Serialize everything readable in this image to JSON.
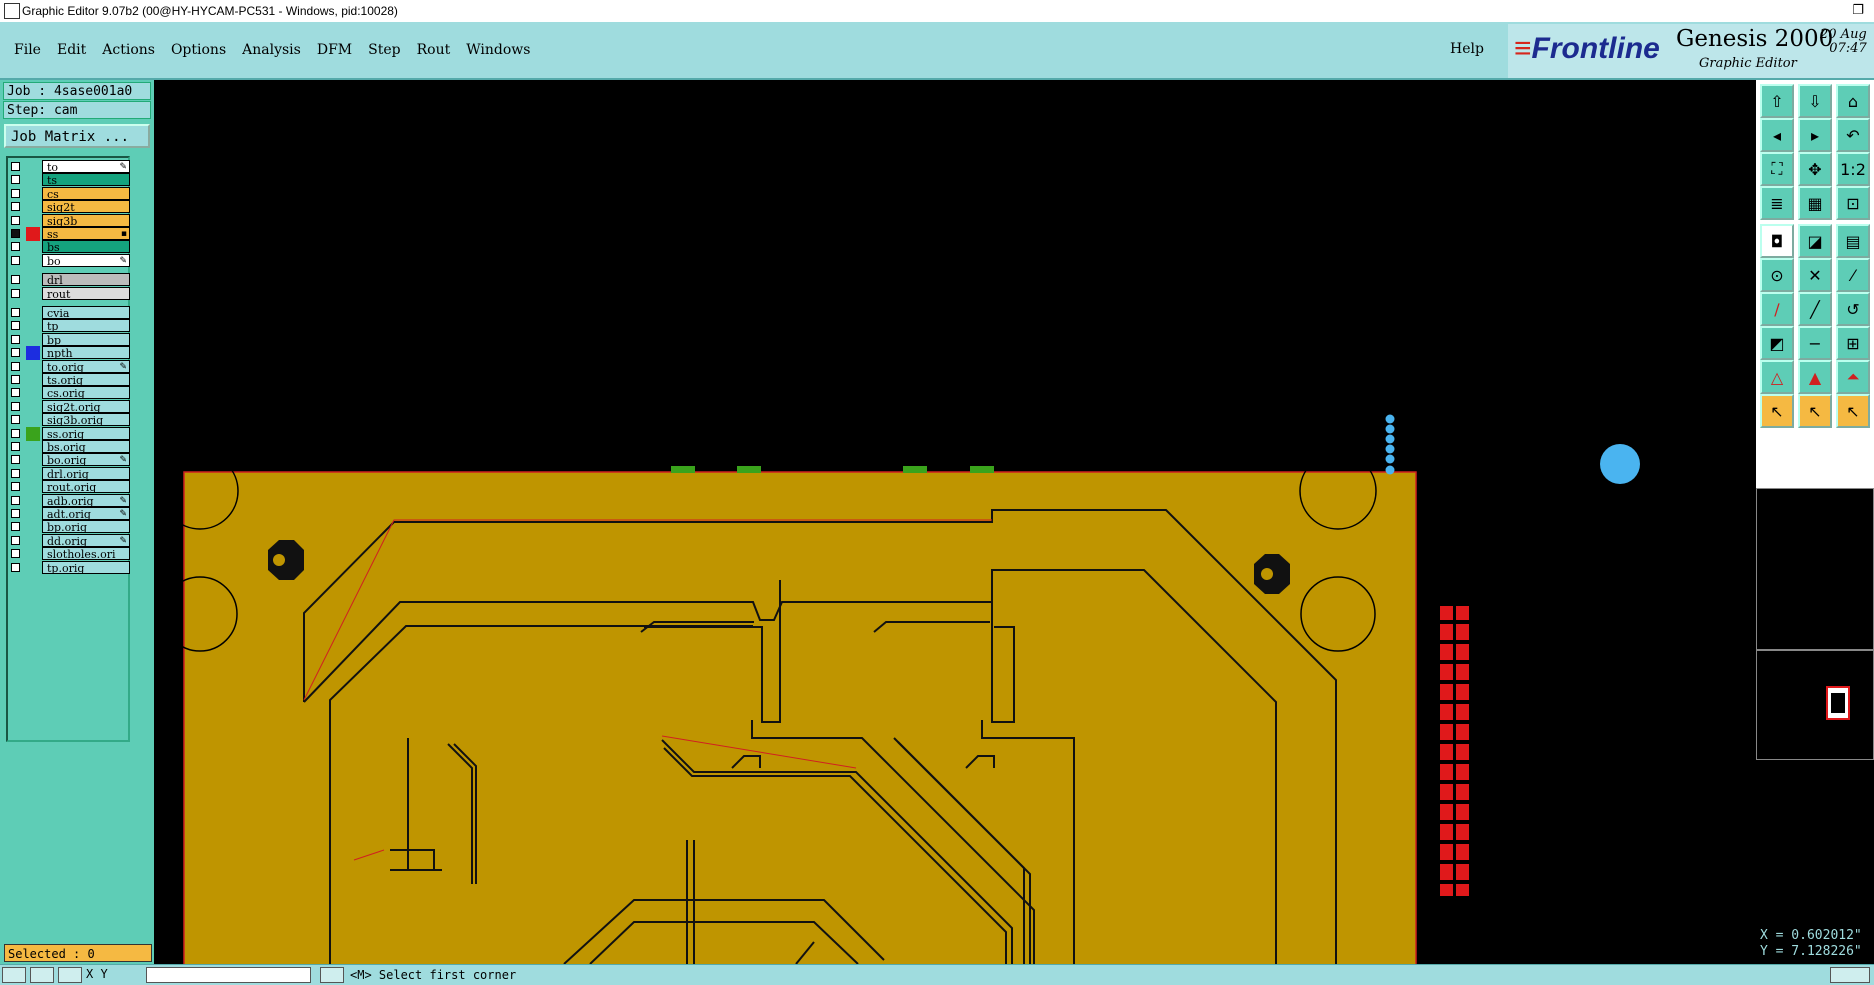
{
  "window": {
    "title": "Graphic Editor 9.07b2 (00@HY-HYCAM-PC531 - Windows, pid:10028)",
    "restore_icon": "restore-icon"
  },
  "menu": {
    "items": [
      "File",
      "Edit",
      "Actions",
      "Options",
      "Analysis",
      "DFM",
      "Step",
      "Rout",
      "Windows"
    ],
    "help": "Help"
  },
  "logo": {
    "brand": "Frontline",
    "product": "Genesis 2000",
    "subtitle": "Graphic Editor",
    "date_line1": "20 Aug",
    "date_line2": "07:47"
  },
  "job": {
    "job_line": "Job : 4sase001a0",
    "step_line": "Step: cam",
    "matrix_button": "Job Matrix ..."
  },
  "layers": [
    {
      "name": "to",
      "color": "#ffffff",
      "mark": "✎"
    },
    {
      "name": "ts",
      "color": "#14a37e"
    },
    {
      "name": "cs",
      "color": "#f5b942"
    },
    {
      "name": "sig2t",
      "color": "#f5b942"
    },
    {
      "name": "sig3b",
      "color": "#f5b942"
    },
    {
      "name": "ss",
      "color": "#f5b942",
      "checked": true,
      "swatch": "#e0191b",
      "mark": "▪"
    },
    {
      "name": "bs",
      "color": "#14a37e"
    },
    {
      "name": "bo",
      "color": "#ffffff",
      "mark": "✎"
    },
    {
      "name": "drl",
      "color": "#bcbcbc"
    },
    {
      "name": "rout",
      "color": "#dddddd"
    },
    {
      "name": "cvia",
      "color": "#9fdcde"
    },
    {
      "name": "tp",
      "color": "#9fdcde"
    },
    {
      "name": "bp",
      "color": "#9fdcde"
    },
    {
      "name": "npth",
      "color": "#9fdcde",
      "swatch": "#1c2de0"
    },
    {
      "name": "to.orig",
      "color": "#9fdcde",
      "mark": "✎"
    },
    {
      "name": "ts.orig",
      "color": "#9fdcde"
    },
    {
      "name": "cs.orig",
      "color": "#9fdcde"
    },
    {
      "name": "sig2t.orig",
      "color": "#9fdcde"
    },
    {
      "name": "sig3b.orig",
      "color": "#9fdcde"
    },
    {
      "name": "ss.orig",
      "color": "#9fdcde",
      "swatch": "#3aa31c"
    },
    {
      "name": "bs.orig",
      "color": "#9fdcde"
    },
    {
      "name": "bo.orig",
      "color": "#9fdcde",
      "mark": "✎"
    },
    {
      "name": "drl.orig",
      "color": "#9fdcde"
    },
    {
      "name": "rout.orig",
      "color": "#9fdcde"
    },
    {
      "name": "adb.orig",
      "color": "#9fdcde",
      "mark": "✎"
    },
    {
      "name": "adt.orig",
      "color": "#9fdcde",
      "mark": "✎"
    },
    {
      "name": "bp.orig",
      "color": "#9fdcde"
    },
    {
      "name": "dd.orig",
      "color": "#9fdcde",
      "mark": "✎"
    },
    {
      "name": "slotholes.ori",
      "color": "#9fdcde"
    },
    {
      "name": "tp.orig",
      "color": "#9fdcde"
    }
  ],
  "selected_label": "Selected : 0",
  "coords": {
    "x": "X = 0.602012\"",
    "y": "Y = 7.128226\""
  },
  "status": {
    "prompt": "<M> Select first corner",
    "field_label": "X  Y"
  },
  "colors": {
    "board": "#bf9500",
    "panel": "#5ecdb6",
    "menu": "#9fdcde",
    "accent_red": "#e0191b"
  },
  "tools": [
    "move-up-icon",
    "move-down-icon",
    "home-icon",
    "pan-left-icon",
    "pan-right-icon",
    "undo-zoom-icon",
    "zoom-fit-icon",
    "zoom-center-icon",
    "zoom-ratio-icon",
    "layers-icon",
    "grid-icon",
    "snap-icon",
    "fill-icon",
    "shape-icon",
    "ruler-icon",
    "pad-icon",
    "cross-icon",
    "line-icon",
    "line-red-icon",
    "slash-icon",
    "arc-icon",
    "corner-icon",
    "minus-icon",
    "measure-icon",
    "triangle-icon",
    "triangle2-icon",
    "triangle3-icon",
    "pointer-icon",
    "pointer2-icon",
    "pointer3-icon"
  ]
}
